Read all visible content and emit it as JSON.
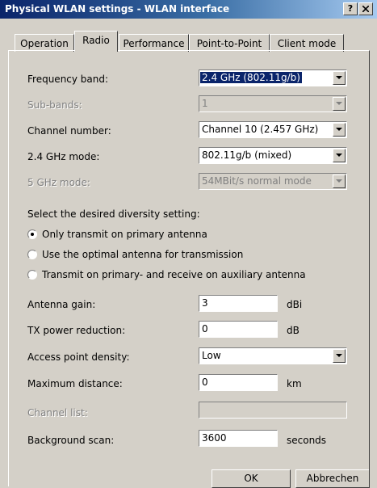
{
  "window": {
    "title": "Physical WLAN settings - WLAN interface",
    "help_label": "?",
    "close_label": "x"
  },
  "tabs": [
    {
      "label": "Operation",
      "active": false
    },
    {
      "label": "Radio",
      "active": true
    },
    {
      "label": "Performance",
      "active": false
    },
    {
      "label": "Point-to-Point",
      "active": false
    },
    {
      "label": "Client mode",
      "active": false
    }
  ],
  "radio": {
    "frequency_band": {
      "label": "Frequency band:",
      "value": "2.4 GHz (802.11g/b)"
    },
    "sub_bands": {
      "label": "Sub-bands:",
      "value": "1",
      "disabled": true
    },
    "channel_number": {
      "label": "Channel number:",
      "value": "Channel 10 (2.457 GHz)"
    },
    "mode_24": {
      "label": "2.4 GHz mode:",
      "value": "802.11g/b (mixed)"
    },
    "mode_5": {
      "label": "5 GHz mode:",
      "value": "54MBit/s normal mode",
      "disabled": true
    },
    "diversity": {
      "heading": "Select the desired diversity setting:",
      "options": [
        {
          "label": "Only transmit on primary antenna",
          "selected": true
        },
        {
          "label": "Use the optimal antenna for transmission",
          "selected": false
        },
        {
          "label": "Transmit on primary- and receive on auxiliary antenna",
          "selected": false
        }
      ]
    },
    "antenna_gain": {
      "label": "Antenna gain:",
      "value": "3",
      "unit": "dBi"
    },
    "tx_power_reduction": {
      "label": "TX power reduction:",
      "value": "0",
      "unit": "dB"
    },
    "ap_density": {
      "label": "Access point density:",
      "value": "Low"
    },
    "max_distance": {
      "label": "Maximum distance:",
      "value": "0",
      "unit": "km"
    },
    "channel_list": {
      "label": "Channel list:",
      "value": ""
    },
    "background_scan": {
      "label": "Background scan:",
      "value": "3600",
      "unit": "seconds"
    }
  },
  "buttons": {
    "ok": "OK",
    "cancel": "Abbrechen"
  }
}
